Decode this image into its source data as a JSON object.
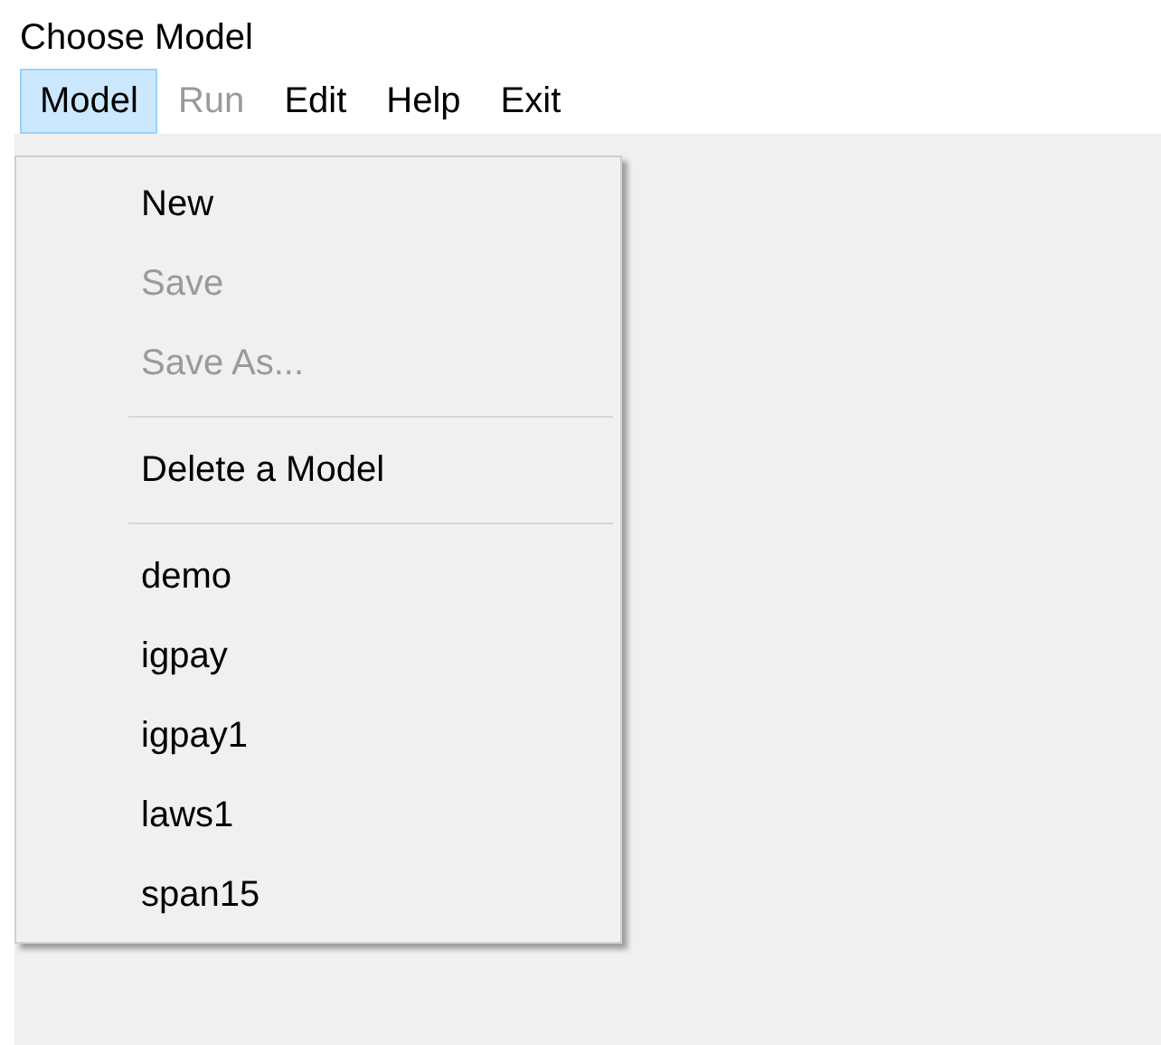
{
  "window": {
    "title": "Choose Model"
  },
  "menubar": [
    {
      "label": "Model",
      "selected": true,
      "disabled": false
    },
    {
      "label": "Run",
      "selected": false,
      "disabled": true
    },
    {
      "label": "Edit",
      "selected": false,
      "disabled": false
    },
    {
      "label": "Help",
      "selected": false,
      "disabled": false
    },
    {
      "label": "Exit",
      "selected": false,
      "disabled": false
    }
  ],
  "dropdown": [
    {
      "kind": "item",
      "label": "New",
      "disabled": false
    },
    {
      "kind": "item",
      "label": "Save",
      "disabled": true
    },
    {
      "kind": "item",
      "label": "Save As...",
      "disabled": true
    },
    {
      "kind": "separator"
    },
    {
      "kind": "item",
      "label": "Delete a Model",
      "disabled": false
    },
    {
      "kind": "separator"
    },
    {
      "kind": "item",
      "label": "demo",
      "disabled": false
    },
    {
      "kind": "item",
      "label": "igpay",
      "disabled": false
    },
    {
      "kind": "item",
      "label": "igpay1",
      "disabled": false
    },
    {
      "kind": "item",
      "label": "laws1",
      "disabled": false
    },
    {
      "kind": "item",
      "label": "span15",
      "disabled": false
    }
  ]
}
